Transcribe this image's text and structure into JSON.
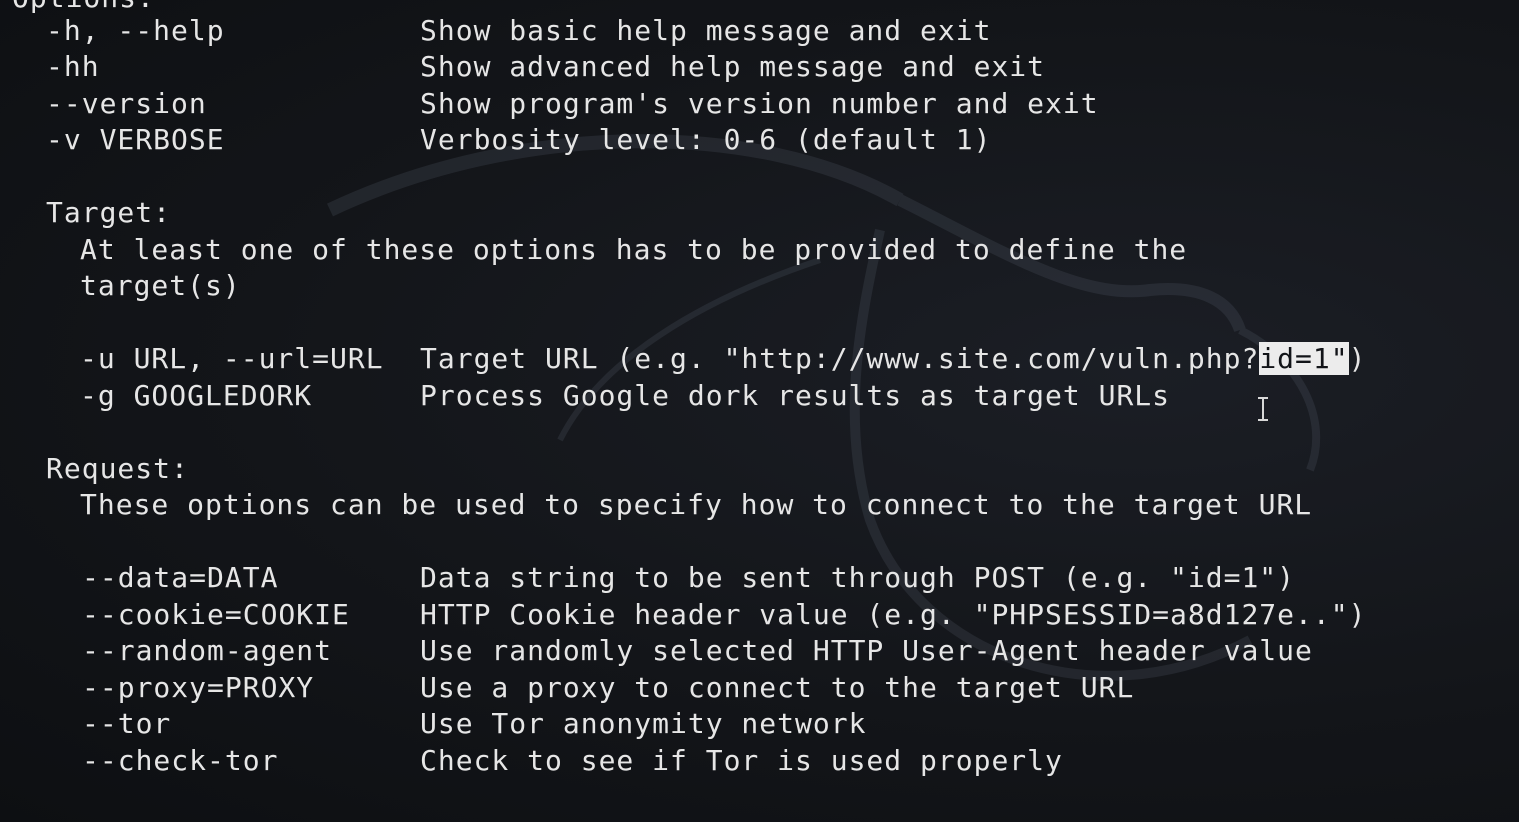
{
  "options_header": "Options:",
  "general_options": [
    {
      "flag": "-h, --help",
      "desc": "Show basic help message and exit"
    },
    {
      "flag": "-hh",
      "desc": "Show advanced help message and exit"
    },
    {
      "flag": "--version",
      "desc": "Show program's version number and exit"
    },
    {
      "flag": "-v VERBOSE",
      "desc": "Verbosity level: 0-6 (default 1)"
    }
  ],
  "target": {
    "header": "Target:",
    "intro_line1": "At least one of these options has to be provided to define the",
    "intro_line2": "target(s)",
    "options": [
      {
        "flag": "-u URL, --url=URL",
        "desc_before": "Target URL (e.g. \"http://www.site.com/vuln.php?",
        "desc_selected": "id=1\"",
        "desc_after": ")"
      },
      {
        "flag": "-g GOOGLEDORK",
        "desc": "Process Google dork results as target URLs"
      }
    ]
  },
  "request": {
    "header": "Request:",
    "intro": "These options can be used to specify how to connect to the target URL",
    "options": [
      {
        "flag": "--data=DATA",
        "desc": "Data string to be sent through POST (e.g. \"id=1\")"
      },
      {
        "flag": "--cookie=COOKIE",
        "desc": "HTTP Cookie header value (e.g. \"PHPSESSID=a8d127e..\")"
      },
      {
        "flag": "--random-agent",
        "desc": "Use randomly selected HTTP User-Agent header value"
      },
      {
        "flag": "--proxy=PROXY",
        "desc": "Use a proxy to connect to the target URL"
      },
      {
        "flag": "--tor",
        "desc": "Use Tor anonymity network"
      },
      {
        "flag": "--check-tor",
        "desc": "Check to see if Tor is used properly"
      }
    ]
  },
  "colors": {
    "background": "#131519",
    "text": "#e6e6e6",
    "selection": "#ececec"
  }
}
